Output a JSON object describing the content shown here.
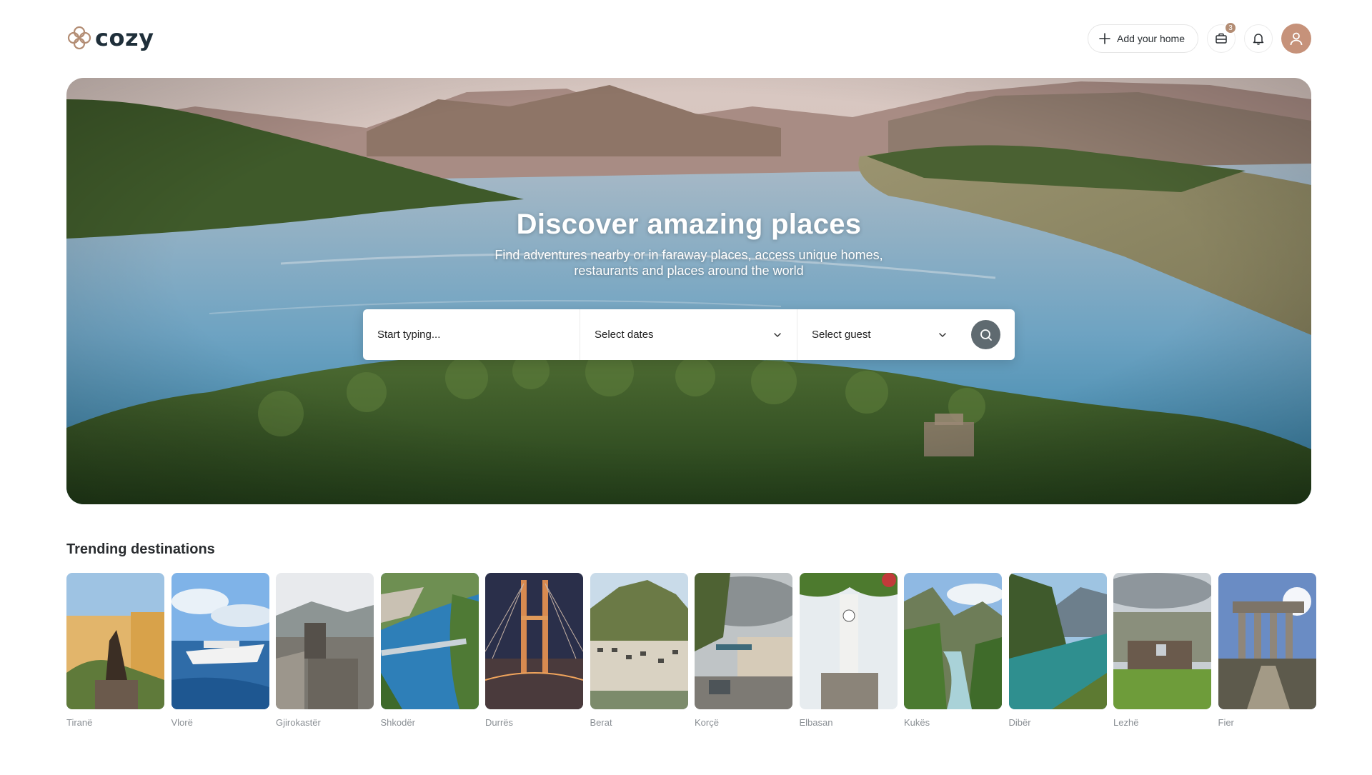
{
  "header": {
    "logo_text": "cozy",
    "add_home_label": "Add your home",
    "trips_badge": "3"
  },
  "hero": {
    "title": "Discover amazing places",
    "subtitle": "Find adventures nearby or in faraway places, access unique homes, restaurants and places around the world"
  },
  "search": {
    "location_placeholder": "Start typing...",
    "dates_label": "Select dates",
    "guests_label": "Select guest"
  },
  "trending": {
    "title": "Trending destinations",
    "destinations": [
      {
        "name": "Tiranë"
      },
      {
        "name": "Vlorë"
      },
      {
        "name": "Gjirokastër"
      },
      {
        "name": "Shkodër"
      },
      {
        "name": "Durrës"
      },
      {
        "name": "Berat"
      },
      {
        "name": "Korçë"
      },
      {
        "name": "Elbasan"
      },
      {
        "name": "Kukës"
      },
      {
        "name": "Dibër"
      },
      {
        "name": "Lezhë"
      },
      {
        "name": "Fier"
      }
    ]
  },
  "colors": {
    "accent": "#b38d74",
    "avatar": "#c6927a",
    "search_button": "#5f6a70",
    "muted_text": "#8a8f94"
  }
}
